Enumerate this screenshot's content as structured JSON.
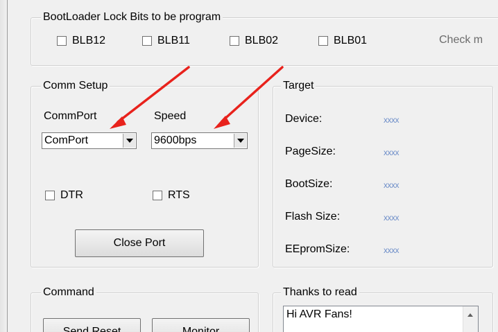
{
  "bootloader": {
    "title": "BootLoader Lock Bits to be program",
    "checkboxes": [
      {
        "label": "BLB12",
        "checked": false
      },
      {
        "label": "BLB11",
        "checked": false
      },
      {
        "label": "BLB02",
        "checked": false
      },
      {
        "label": "BLB01",
        "checked": false
      }
    ],
    "check_text": "Check m"
  },
  "comm_setup": {
    "title": "Comm Setup",
    "commport_label": "CommPort",
    "commport_value": "ComPort",
    "speed_label": "Speed",
    "speed_value": "9600bps",
    "dtr_label": "DTR",
    "dtr_checked": false,
    "rts_label": "RTS",
    "rts_checked": false,
    "close_port_label": "Close Port"
  },
  "target": {
    "title": "Target",
    "rows": [
      {
        "label": "Device:",
        "value": "xxxx"
      },
      {
        "label": "PageSize:",
        "value": "xxxx"
      },
      {
        "label": "BootSize:",
        "value": "xxxx"
      },
      {
        "label": "Flash Size:",
        "value": "xxxx"
      },
      {
        "label": "EEpromSize:",
        "value": "xxxx"
      }
    ]
  },
  "command": {
    "title": "Command",
    "send_reset_label": "Send Reset",
    "monitor_label": "Monitor"
  },
  "thanks": {
    "title": "Thanks to read",
    "text": "Hi AVR Fans!"
  },
  "colors": {
    "annotation_arrow": "#e8221c",
    "value_text": "#6f8fc9"
  },
  "annotations": [
    "red-arrow-to-commport",
    "red-arrow-to-speed"
  ]
}
